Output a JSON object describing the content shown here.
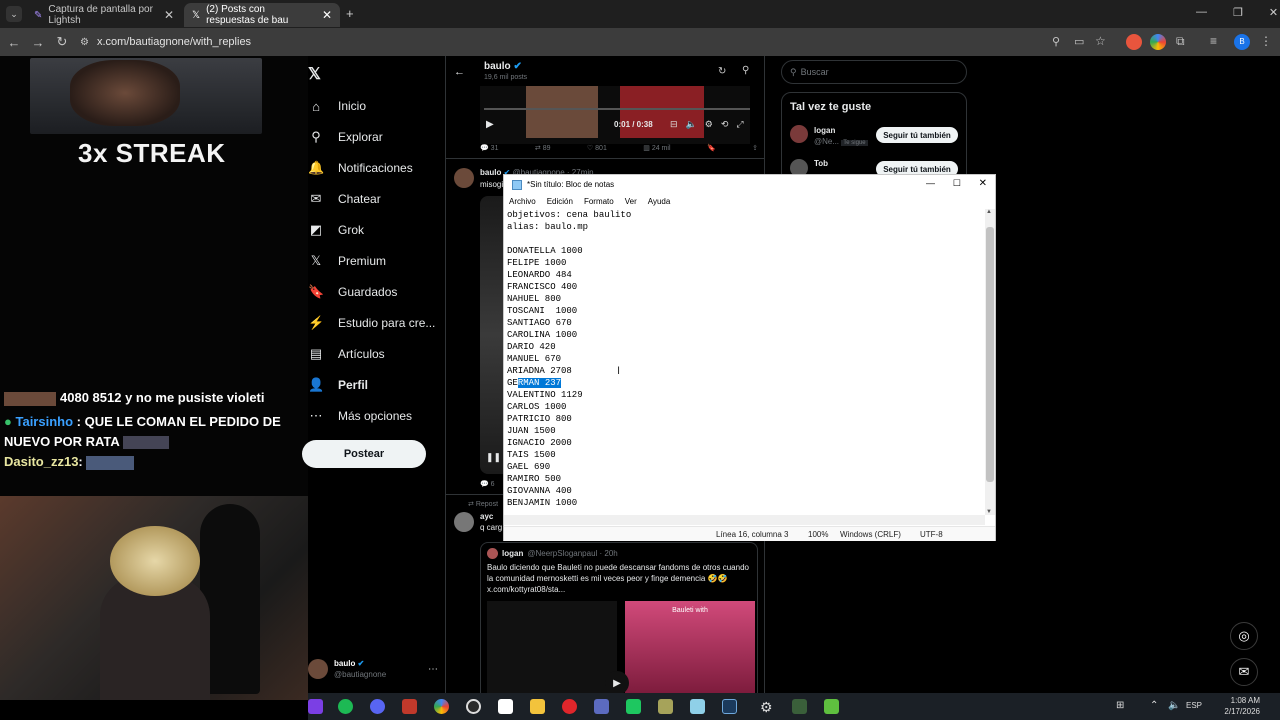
{
  "browser": {
    "tabs": [
      {
        "title": "Captura de pantalla por Lightsh",
        "active": false
      },
      {
        "title": "(2) Posts con respuestas de bau",
        "active": true
      }
    ],
    "url": "x.com/bautiagnone/with_replies"
  },
  "stream": {
    "streak_text": "3x STREAK",
    "chat": [
      {
        "user": "",
        "message": "4080 8512 y no me pusiste violeti"
      },
      {
        "user": "Tairsinho",
        "message": ": QUE LE COMAN EL PEDIDO DE NUEVO POR RATA"
      },
      {
        "user": "Dasito_zz13",
        "message": ":"
      }
    ]
  },
  "x_nav": {
    "items": [
      {
        "icon": "home-icon",
        "glyph": "⌂",
        "label": "Inicio"
      },
      {
        "icon": "search-icon",
        "glyph": "⚲",
        "label": "Explorar"
      },
      {
        "icon": "bell-icon",
        "glyph": "🔔",
        "label": "Notificaciones"
      },
      {
        "icon": "mail-icon",
        "glyph": "✉",
        "label": "Chatear"
      },
      {
        "icon": "grok-icon",
        "glyph": "◩",
        "label": "Grok"
      },
      {
        "icon": "x-premium-icon",
        "glyph": "𝕏",
        "label": "Premium"
      },
      {
        "icon": "bookmark-icon",
        "glyph": "🔖",
        "label": "Guardados"
      },
      {
        "icon": "studio-icon",
        "glyph": "⚡",
        "label": "Estudio para cre..."
      },
      {
        "icon": "article-icon",
        "glyph": "▤",
        "label": "Artículos"
      },
      {
        "icon": "person-icon",
        "glyph": "👤",
        "label": "Perfil"
      },
      {
        "icon": "more-icon",
        "glyph": "⋯",
        "label": "Más opciones"
      }
    ],
    "post_button": "Postear",
    "account": {
      "name": "baulo",
      "handle": "@bautiagnone"
    }
  },
  "timeline": {
    "header_name": "baulo",
    "header_posts": "19,6 mil posts",
    "video_time": "0:01 / 0:38",
    "tweet1_stats": {
      "replies": "31",
      "retweets": "89",
      "likes": "801",
      "views": "24 mil"
    },
    "tweet2": {
      "name": "baulo",
      "handle": "@bautiagnone · 27min",
      "text": "misogi"
    },
    "tweet2_replies": "6",
    "repost_label": "Repost",
    "tweet3": {
      "name": "ayc",
      "text": "q carg"
    },
    "quote": {
      "name": "logan",
      "handle": "@NeerpSloganpaul · 20h",
      "text": "Baulo diciendo que Bauleti no puede descansar fandoms de otros cuando la comunidad mernosketti es mil veces peor y finge demencia 🤣🤣 x.com/kottyrat08/sta..."
    },
    "image_caption": "Bauleti with"
  },
  "right": {
    "search_placeholder": "Buscar",
    "wtf_title": "Tal vez te guste",
    "suggestions": [
      {
        "name": "logan",
        "handle": "@Ne...",
        "badge": "Te sigue",
        "button": "Seguir tú también"
      },
      {
        "name": "Tob",
        "handle": "",
        "badge": "",
        "button": "Seguir tú también"
      }
    ]
  },
  "notepad": {
    "title": "*Sin título: Bloc de notas",
    "menu": [
      "Archivo",
      "Edición",
      "Formato",
      "Ver",
      "Ayuda"
    ],
    "lines_before": "objetivos: cena baulito\nalias: baulo.mp\n\nDONATELLA 1000\nFELIPE 1000\nLEONARDO 484\nFRANCISCO 400\nNAHUEL 800\nTOSCANI  1000\nSANTIAGO 670\nCAROLINA 1000\nDARIO 420\nMANUEL 670\nARIADNA 2708\n",
    "selected_line_prefix": "GE",
    "selected_text": "RMAN 237",
    "lines_after": "\nVALENTINO 1129\nCARLOS 1000\nPATRICIO 800\nJUAN 1500\nIGNACIO 2000\nTAIS 1500\nGAEL 690\nRAMIRO 500\nGIOVANNA 400\nBENJAMIN 1000",
    "status": {
      "position": "Línea 16, columna 3",
      "zoom": "100%",
      "eol": "Windows (CRLF)",
      "encoding": "UTF-8"
    }
  },
  "taskbar": {
    "lang": "ESP",
    "time": "1:08 AM",
    "date": "2/17/2026"
  }
}
